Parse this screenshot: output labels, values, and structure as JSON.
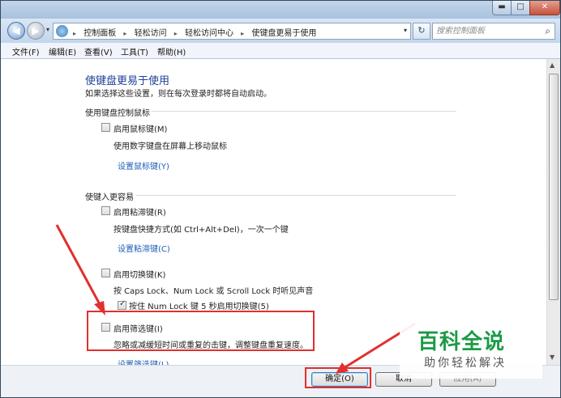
{
  "window": {
    "min_symbol": "▬",
    "max_symbol": "□",
    "close_symbol": "✕"
  },
  "nav": {
    "back_icon": "arrow-left-icon",
    "back_symbol": "◀",
    "forward_symbol": "▶",
    "drop_symbol": "▾",
    "breadcrumbs": [
      "控制面板",
      "轻松访问",
      "轻松访问中心",
      "使键盘更易于使用"
    ],
    "separator": "▸",
    "refresh_symbol": "↻",
    "search_placeholder": "搜索控制面板",
    "search_symbol": "⌕"
  },
  "menu": [
    "文件(F)",
    "编辑(E)",
    "查看(V)",
    "工具(T)",
    "帮助(H)"
  ],
  "content": {
    "title": "使键盘更易于使用",
    "subtitle": "如果选择这些设置，则在每次登录时都将自动启动。",
    "group_mouse": {
      "heading": "使用键盘控制鼠标",
      "checkbox_label": "启用鼠标键(M)",
      "checked": false,
      "desc": "使用数字键盘在屏幕上移动鼠标",
      "link": "设置鼠标键(Y)"
    },
    "group_typing": {
      "heading": "使键入更容易",
      "sticky": {
        "label": "启用粘滞键(R)",
        "checked": false,
        "desc": "按键盘快捷方式(如 Ctrl+Alt+Del)，一次一个键",
        "link": "设置粘滞键(C)"
      },
      "toggle": {
        "label": "启用切换键(K)",
        "checked": false,
        "desc": "按 Caps Lock、Num Lock 或 Scroll Lock 时听见声音",
        "sub_label": "按住 Num Lock 键 5 秒启用切换键(5)",
        "sub_checked": true
      },
      "filter": {
        "label": "启用筛选键(I)",
        "checked": false,
        "desc": "忽略或减缓短时间或重复的击键，调整键盘重复速度。",
        "link": "设置筛选键(L)"
      }
    }
  },
  "buttons": {
    "ok": "确定(O)",
    "cancel": "取消",
    "apply": "应用(A)"
  },
  "watermark": {
    "big": "百科全说",
    "small": "助你轻松解决"
  },
  "colors": {
    "annotation_red": "#e0302f",
    "title_blue": "#1c3f96",
    "link_blue": "#1d5fb8",
    "watermark_green": "#1b9b45"
  }
}
